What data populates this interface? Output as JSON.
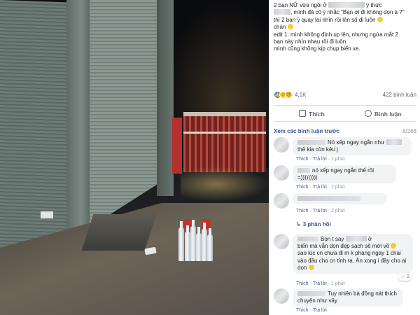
{
  "post": {
    "lines": [
      "2 bạn NỮ vừa ngồi ở",
      "ý thức",
      ", mình đã có ý nhắc \"Bạn ơi đi không dọn à ?\"",
      "thì 2 bạn ý quay lại nhìn rồi lên số đi luôn",
      "chán",
      "edit 1: mình không định up lên, nhưng ngứa mắt 2",
      "bạn này nhìn nhau rồi đi luôn",
      "mình cũng không kịp chụp biển xe."
    ],
    "reaction_count": "4,1K",
    "comment_count": "422 bình luận"
  },
  "actions": {
    "like": "Thích",
    "comment": "Bình luận"
  },
  "comments_header": {
    "more": "Xem các bình luận trước",
    "pager": "8/268"
  },
  "comments": [
    {
      "text_a": "Nó xếp ngay ngắn như",
      "text_b": "thế kia còn kêu j",
      "like": "Thích",
      "reply": "Trả lời",
      "time": "1 phút"
    },
    {
      "text_a": "nó xếp ngay ngắn thế rồi =)))))))))",
      "like": "Thích",
      "reply": "Trả lời",
      "time": "2 phút"
    },
    {
      "like": "Thích",
      "reply": "Trả lời",
      "time": "2 phút",
      "replies": "3 phản hồi"
    },
    {
      "text_a": "Bọn t say",
      "text_b": "ở",
      "text_c": "biển mà vẫn dọn đẹp sạch sẽ mới về",
      "text_d": "sao lúc cn chưa đi m k phang ngay 1 chai",
      "text_e": "vào đầu cho cn tỉnh ra. Ăn xong i đầy cho ai",
      "text_f": "dọn",
      "like": "Thích",
      "reply": "Trả lời",
      "time": "1 phút",
      "react_count": "2"
    },
    {
      "text_a": "Tuy nhiên bà đồng nát thích",
      "text_b": "chuyện như vầy",
      "like": "Thích",
      "reply": "Trả lời"
    }
  ],
  "colors": {
    "link": "#385898",
    "muted": "#90949c",
    "bubble": "#f2f3f5",
    "like_blue": "#2078f4"
  }
}
